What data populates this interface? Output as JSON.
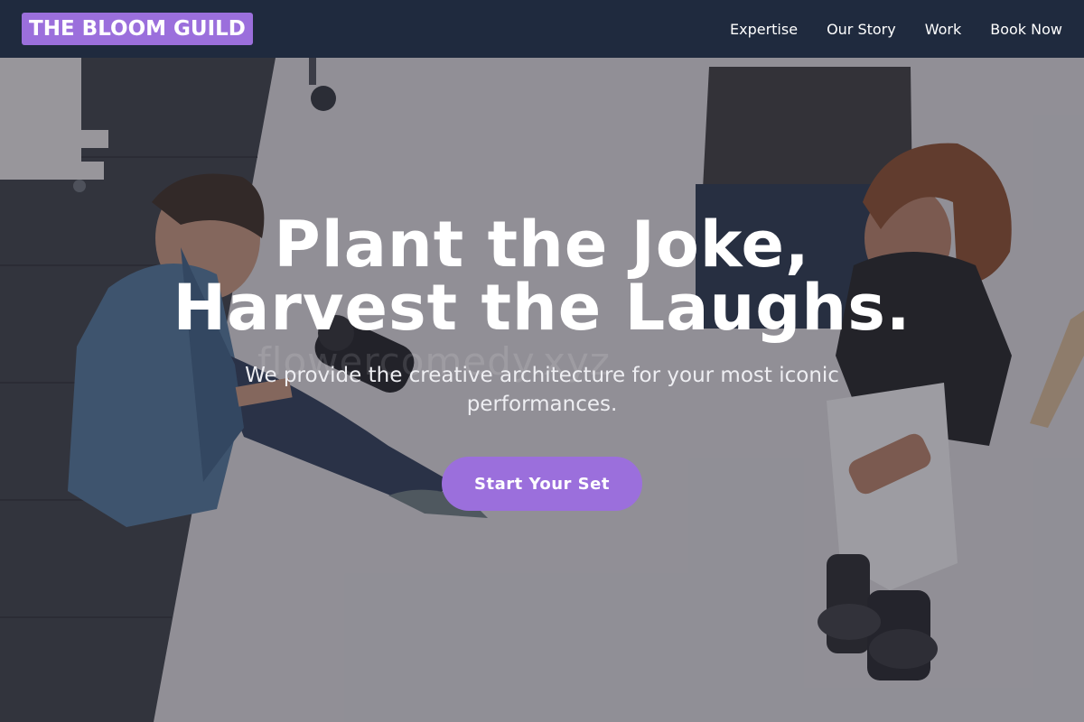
{
  "brand": {
    "logo_text": "THE BLOOM GUILD",
    "accent_color": "#9b6fdc"
  },
  "nav": {
    "items": [
      {
        "label": "Expertise"
      },
      {
        "label": "Our Story"
      },
      {
        "label": "Work"
      },
      {
        "label": "Book Now"
      }
    ]
  },
  "hero": {
    "headline_line1": "Plant the Joke,",
    "headline_line2": "Harvest the Laughs.",
    "subhead": "We provide the creative architecture for your most iconic performances.",
    "cta_label": "Start Your Set",
    "watermark": "flowercomedy.xyz"
  }
}
